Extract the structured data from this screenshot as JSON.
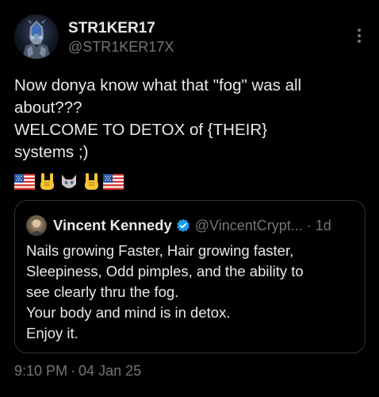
{
  "author": {
    "display_name": "STR1KER17",
    "handle": "@STR1KER17X"
  },
  "tweet": {
    "lines": [
      "Now donya know what that \"fog\" was all",
      "about???",
      "WELCOME TO DETOX of {THEIR}",
      "systems ;)"
    ],
    "emojis": [
      "us-flag-icon",
      "horns-hand-icon",
      "cat-face-icon",
      "horns-hand-icon",
      "us-flag-icon"
    ]
  },
  "quoted_tweet": {
    "display_name": "Vincent Kennedy",
    "verified": true,
    "handle": "@VincentCrypt...",
    "separator": "·",
    "time": "1d",
    "lines": [
      "Nails growing Faster, Hair growing faster,",
      "Sleepiness, Odd pimples, and the ability to",
      "see clearly thru the fog.",
      "Your body and mind is in detox.",
      "Enjoy it."
    ]
  },
  "meta": {
    "time": "9:10 PM",
    "separator": "·",
    "date": "04 Jan 25"
  },
  "colors": {
    "background": "#000000",
    "text_primary": "#e7e9ea",
    "text_secondary": "#71767b",
    "border": "#2f3336",
    "verified_blue": "#1d9bf0"
  }
}
